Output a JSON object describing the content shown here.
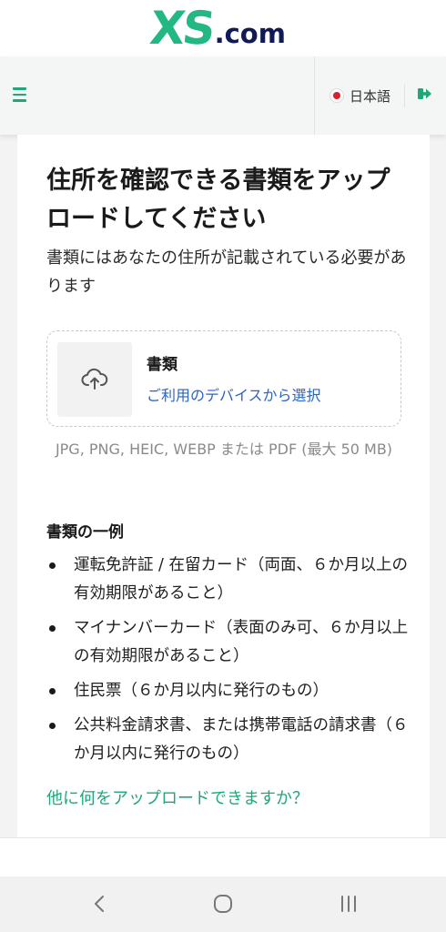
{
  "brand": {
    "logo_xs": "XS",
    "logo_com": ".com",
    "accent": "#23b883",
    "dark": "#111a55"
  },
  "header": {
    "menu_icon": "hamburger-menu-icon",
    "language": {
      "flag_icon": "japan-flag-icon",
      "label": "日本語"
    },
    "logout_icon": "logout-icon"
  },
  "page": {
    "title": "住所を確認できる書類をアップロードしてください",
    "subtitle": "書類にはあなたの住所が記載されている必要があります"
  },
  "upload": {
    "icon": "cloud-upload-icon",
    "title": "書類",
    "link": "ご利用のデバイスから選択",
    "formats": "JPG, PNG, HEIC, WEBP または PDF (最大 50 MB)"
  },
  "examples": {
    "title": "書類の一例",
    "items": [
      "運転免許証 / 在留カード（両面、６か月以上の有効期限があること）",
      "マイナンバーカード（表面のみ可、６か月以上の有効期限があること）",
      "住民票（６か月以内に発行のもの）",
      "公共料金請求書、または携帯電話の請求書（６か月以内に発行のもの）"
    ]
  },
  "help_link": "他に何をアップロードできますか？",
  "system_nav": {
    "back_icon": "back-icon",
    "home_icon": "home-icon",
    "recent_icon": "recent-apps-icon"
  }
}
